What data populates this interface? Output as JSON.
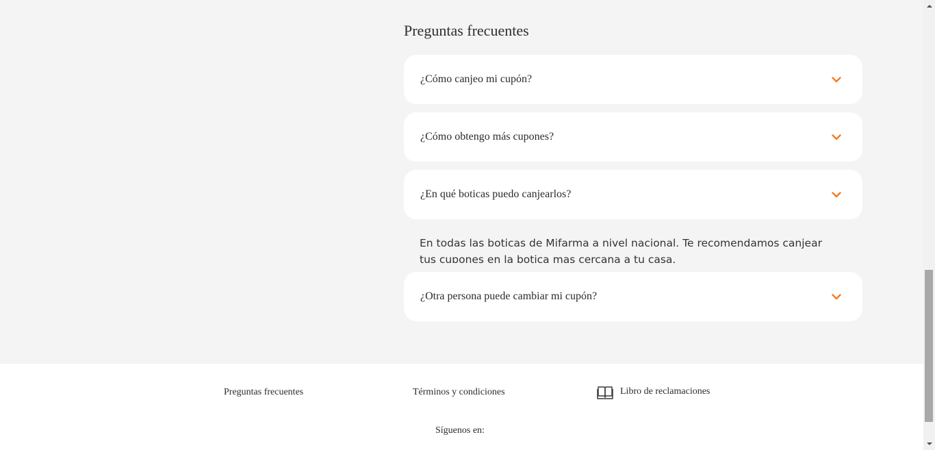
{
  "faq": {
    "title": "Preguntas frecuentes",
    "items": [
      {
        "question": "¿Cómo canjeo mi cupón?"
      },
      {
        "question": "¿Cómo obtengo más cupones?"
      },
      {
        "question": "¿En qué boticas puedo canjearlos?",
        "expanded": true,
        "answer": "En todas las boticas de Mifarma a nivel nacional. Te recomendamos canjear tus cupones en la botica mas cercana a tu casa."
      },
      {
        "question": "¿Otra persona puede cambiar mi cupón?"
      }
    ],
    "accent_color": "#f47b20"
  },
  "footer": {
    "links": {
      "faq": "Preguntas frecuentes",
      "terms": "Términos y condiciones",
      "complaints": "Libro de reclamaciones"
    },
    "follow_label": "Síguenos en:",
    "complaints_icon": "book-icon"
  }
}
